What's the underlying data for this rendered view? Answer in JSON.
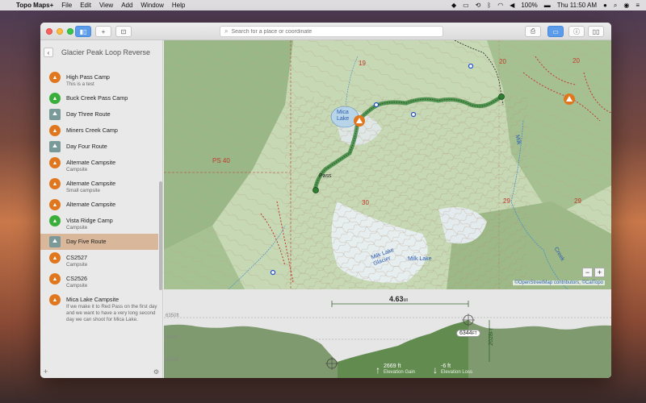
{
  "menubar": {
    "app_name": "Topo Maps+",
    "menus": [
      "File",
      "Edit",
      "View",
      "Add",
      "Window",
      "Help"
    ],
    "battery": "100%",
    "clock": "Thu 11:50 AM"
  },
  "toolbar": {
    "search_placeholder": "Search for a place or coordinate"
  },
  "sidebar": {
    "title": "Glacier Peak Loop Reverse",
    "items": [
      {
        "type": "camp",
        "name": "High Pass Camp",
        "sub": "This is a test"
      },
      {
        "type": "pass",
        "name": "Buck Creek Pass Camp",
        "sub": ""
      },
      {
        "type": "route",
        "name": "Day Three Route",
        "sub": ""
      },
      {
        "type": "camp",
        "name": "Miners Creek Camp",
        "sub": ""
      },
      {
        "type": "route",
        "name": "Day Four Route",
        "sub": ""
      },
      {
        "type": "camp",
        "name": "Alternate Campsite",
        "sub": "Campsite"
      },
      {
        "type": "camp",
        "name": "Alternate Campsite",
        "sub": "Small campsite"
      },
      {
        "type": "camp",
        "name": "Alternate Campsite",
        "sub": ""
      },
      {
        "type": "pass",
        "name": "Vista Ridge Camp",
        "sub": "Campsite"
      },
      {
        "type": "route",
        "name": "Day Five Route",
        "sub": ""
      },
      {
        "type": "camp",
        "name": "CS2527",
        "sub": "Campsite"
      },
      {
        "type": "camp",
        "name": "CS2526",
        "sub": "Campsite"
      },
      {
        "type": "camp",
        "name": "Mica Lake Campsite",
        "sub": "If we make it to Red Pass on the first day and we want to have a very long second day we can shoot for Mica Lake."
      }
    ],
    "selected_index": 9
  },
  "map": {
    "labels": {
      "l19": "19",
      "l20a": "20",
      "l20b": "20",
      "l30": "30",
      "l29a": "29",
      "l29b": "29",
      "ps40": "PS 40",
      "mica_lake": "Mica Lake",
      "milk_lake_glacier": "Milk Lake Glacier",
      "milk_lake": "Milk Lake",
      "milk": "Milk",
      "creek": "Creek",
      "pass": "Pass"
    },
    "attribution_osm": "©OpenStreetMap contributors",
    "attribution_caltopo": "©CalTopo",
    "colors": {
      "route": "#2e7d32",
      "campsite": "#e0771f",
      "boundary": "#c0392b"
    }
  },
  "elevation": {
    "max_label": "6350ft",
    "mid_label": "5611ft",
    "min_label": "4874ft",
    "distance": "4.63",
    "distance_unit": "MI",
    "peak": "6344",
    "peak_unit": "FT",
    "rise": "2028",
    "rise_unit": "FT",
    "gain_value": "2669 ft",
    "gain_label": "Elevation Gain",
    "loss_value": "-6 ft",
    "loss_label": "Elevation Loss"
  }
}
